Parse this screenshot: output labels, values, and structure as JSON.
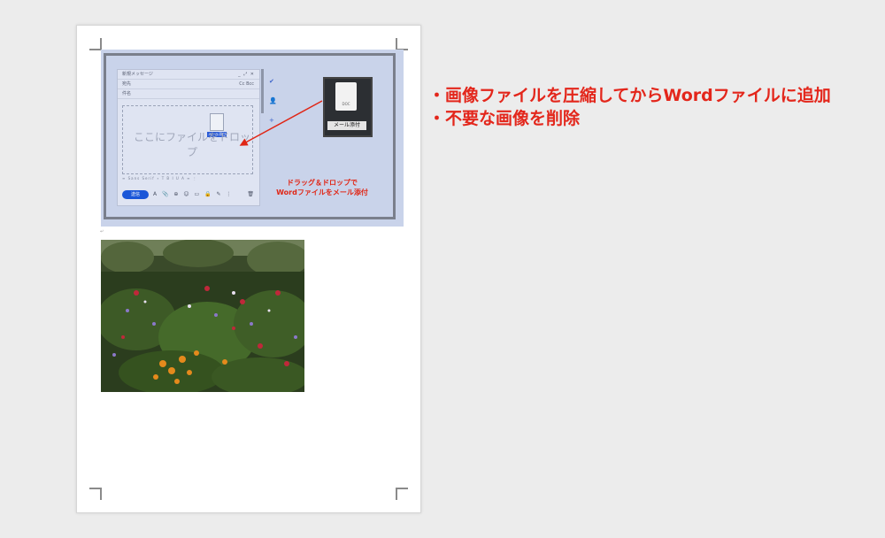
{
  "document": {
    "embedded_mail": {
      "window_title": "新規メッセージ",
      "window_controls": "_ ⤢ ✕",
      "to_label": "宛先",
      "cc_bcc": "Cc Bcc",
      "subject_label": "件名",
      "drop_hint": "ここにファイルをドロップ",
      "drag_tag": "メール添付",
      "format_bar": "≡ Sans Serif ∙ T B I U A ≡ ⋮",
      "send_label": "送信",
      "toolbar_icons": "A 📎 ⊕ ☺ ▭ 🔒 ✎ ⋮",
      "trash": "🗑",
      "side_icons": [
        "✔",
        "👤",
        "+"
      ],
      "doc_thumb_text": "DOC",
      "doc_thumb_label": "メール添付",
      "caption_line1": "ドラッグ＆ドロップで",
      "caption_line2": "Wordファイルをメール添付",
      "arrow_color": "#e02616"
    },
    "photo": {
      "subject": "flower-garden",
      "colors": [
        "#22311a",
        "#3d5a26",
        "#e58a1c",
        "#c0283a",
        "#8b78c9"
      ]
    }
  },
  "notes": [
    "・画像ファイルを圧縮してからWordファイルに追加",
    "・不要な画像を削除"
  ],
  "accent_color": "#e3261b"
}
